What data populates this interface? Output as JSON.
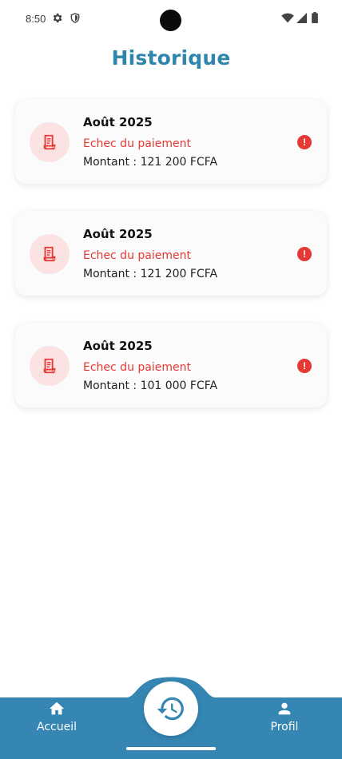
{
  "status_bar": {
    "time": "8:50",
    "icons": [
      "gear-icon",
      "shield-icon",
      "wifi-icon",
      "signal-icon",
      "battery-icon"
    ]
  },
  "page": {
    "title": "Historique"
  },
  "history": {
    "items": [
      {
        "month": "Août 2025",
        "status": "Echec du paiement",
        "amount": "Montant : 121 200 FCFA"
      },
      {
        "month": "Août 2025",
        "status": "Echec du paiement",
        "amount": "Montant : 121 200 FCFA"
      },
      {
        "month": "Août 2025",
        "status": "Echec du paiement",
        "amount": "Montant : 101 000 FCFA"
      }
    ],
    "alert_symbol": "!"
  },
  "bottom_nav": {
    "home_label": "Accueil",
    "profile_label": "Profil",
    "center_icon": "history-icon"
  },
  "colors": {
    "accent": "#2e86ad",
    "nav_bg": "#3586b3",
    "error": "#e53935",
    "icon_bg": "#fbe3e3"
  }
}
